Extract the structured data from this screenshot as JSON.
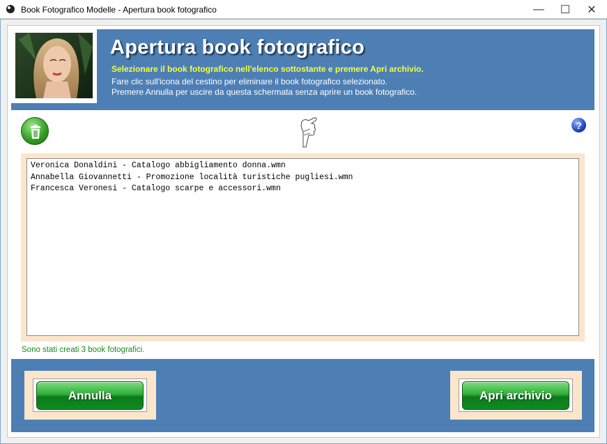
{
  "window": {
    "title": "Book Fotografico Modelle - Apertura book fotografico",
    "controls": {
      "minimize": "—",
      "maximize": "☐",
      "close": "✕"
    }
  },
  "header": {
    "title": "Apertura book fotografico",
    "subtitle": "Selezionare il book fotografico nell'elenco sottostante e premere Apri archivio.",
    "lines": [
      "Fare clic sull'icona del cestino per eliminare il book fotografico selezionato.",
      "Premere Annulla per uscire da questa schermata senza aprire un book fotografico."
    ]
  },
  "toolbar": {
    "help_label": "?"
  },
  "files": [
    "Veronica Donaldini - Catalogo abbigliamento donna.wmn",
    "Annabella Giovannetti - Promozione località turistiche pugliesi.wmn",
    "Francesca Veronesi - Catalogo scarpe e accessori.wmn"
  ],
  "status": "Sono stati creati 3 book fotografici.",
  "buttons": {
    "cancel": "Annulla",
    "open": "Apri archivio"
  },
  "colors": {
    "header_bg": "#4d7fb5",
    "subtitle": "#f2ff3a",
    "status": "#1a8a1a",
    "frame_bg": "#fbe6cb"
  },
  "icons": [
    "app-icon",
    "trash-icon",
    "pointing-hand-icon",
    "help-icon"
  ]
}
